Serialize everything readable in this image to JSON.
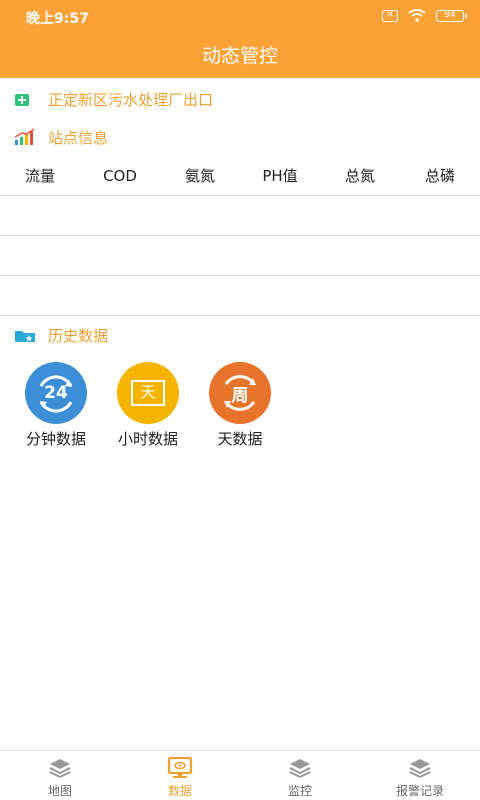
{
  "status": {
    "time": "晚上9:57",
    "sim_text": "✕",
    "battery": "94"
  },
  "header": {
    "title": "动态管控"
  },
  "station": {
    "name": "正定新区污水处理厂出口"
  },
  "site_info": {
    "title": "站点信息"
  },
  "metrics": {
    "columns": [
      "流量",
      "COD",
      "氨氮",
      "PH值",
      "总氮",
      "总磷"
    ]
  },
  "history": {
    "title": "历史数据",
    "items": [
      {
        "label": "分钟数据",
        "badge": "24",
        "color": "#3c8fd6"
      },
      {
        "label": "小时数据",
        "badge": "天",
        "color": "#f4b400"
      },
      {
        "label": "天数据",
        "badge": "周",
        "color": "#e8732a"
      }
    ]
  },
  "bottom_nav": {
    "items": [
      {
        "label": "地图",
        "icon": "layers-icon"
      },
      {
        "label": "数据",
        "icon": "monitor-icon"
      },
      {
        "label": "监控",
        "icon": "layers-icon"
      },
      {
        "label": "报警记录",
        "icon": "layers-icon"
      }
    ],
    "active_index": 1
  },
  "colors": {
    "accent": "#fba236",
    "section_text": "#f0a030"
  }
}
